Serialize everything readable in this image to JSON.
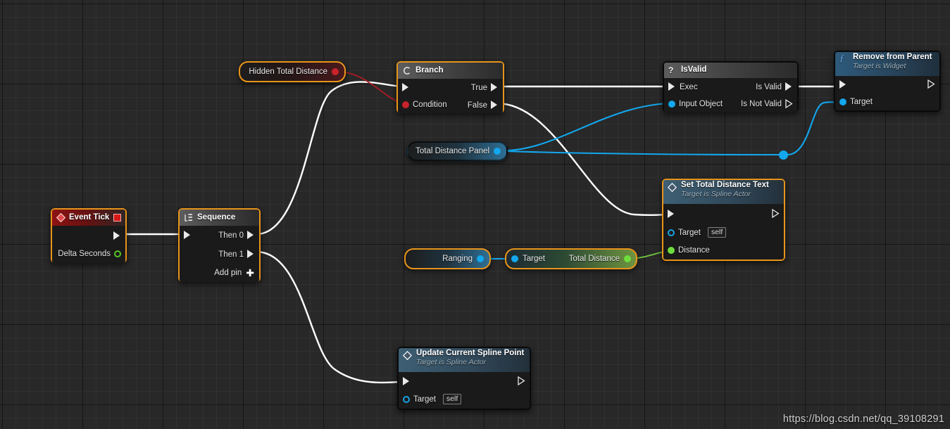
{
  "graph": {
    "watermark": "https://blog.csdn.net/qq_39108291",
    "accent_selected": "#e8941a",
    "wire_exec": "#ffffff",
    "wire_bool": "#a81d24",
    "wire_object": "#13a7ee",
    "wire_float": "#74c942",
    "background": "#282828"
  },
  "nodes": {
    "event_tick": {
      "title": "Event Tick",
      "icon": "event-diamond-icon",
      "stop_icon": "stop-square-icon",
      "out_exec": "",
      "delta_label": "Delta Seconds"
    },
    "sequence": {
      "title": "Sequence",
      "icon": "sequence-icon",
      "in_exec": "",
      "then_0": "Then 0",
      "then_1": "Then 1",
      "add_pin": "Add pin"
    },
    "hidden_total_distance": {
      "label": "Hidden Total Distance"
    },
    "branch": {
      "title": "Branch",
      "icon": "branch-icon",
      "in_exec": "",
      "condition": "Condition",
      "true": "True",
      "false": "False"
    },
    "total_distance_panel": {
      "label": "Total Distance Panel"
    },
    "is_valid": {
      "title": "IsValid",
      "icon": "question-mark-icon",
      "exec": "Exec",
      "input_object": "Input Object",
      "is_valid": "Is Valid",
      "is_not_valid": "Is Not Valid"
    },
    "remove_from_parent": {
      "title": "Remove from Parent",
      "subtitle": "Target is Widget",
      "icon": "function-f-icon",
      "in_exec": "",
      "out_exec": "",
      "target": "Target"
    },
    "set_total_distance_text": {
      "title": "Set Total Distance Text",
      "subtitle": "Target is Spline Actor",
      "icon": "event-diamond-icon",
      "in_exec": "",
      "out_exec": "",
      "target": "Target",
      "target_value": "self",
      "distance": "Distance"
    },
    "ranging": {
      "label": "Ranging"
    },
    "total_distance": {
      "target_label": "Target",
      "output_label": "Total Distance"
    },
    "update_current_spline_point": {
      "title": "Update Current Spline Point",
      "subtitle": "Target is Spline Actor",
      "icon": "event-diamond-icon",
      "in_exec": "",
      "out_exec": "",
      "target": "Target",
      "target_value": "self"
    }
  }
}
